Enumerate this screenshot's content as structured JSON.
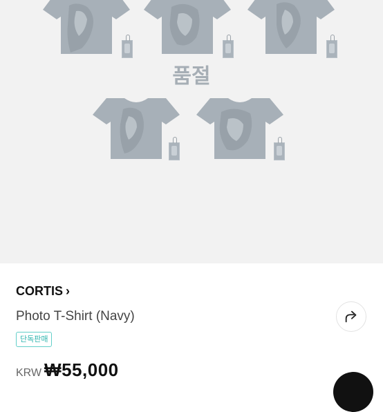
{
  "hero": {
    "status_label": "품절"
  },
  "product": {
    "brand": "CORTIS",
    "brand_chevron": "›",
    "name": "Photo T-Shirt (Navy)",
    "badge": "단독판매",
    "currency": "KRW",
    "price": "₩55,000"
  },
  "colors": {
    "tee": "#a7b0b8",
    "badge_accent": "#2fb5ae",
    "sold_out_text": "#a6aeb5"
  },
  "icons": {
    "share": "share-icon",
    "brand_arrow": "chevron-right-icon"
  }
}
